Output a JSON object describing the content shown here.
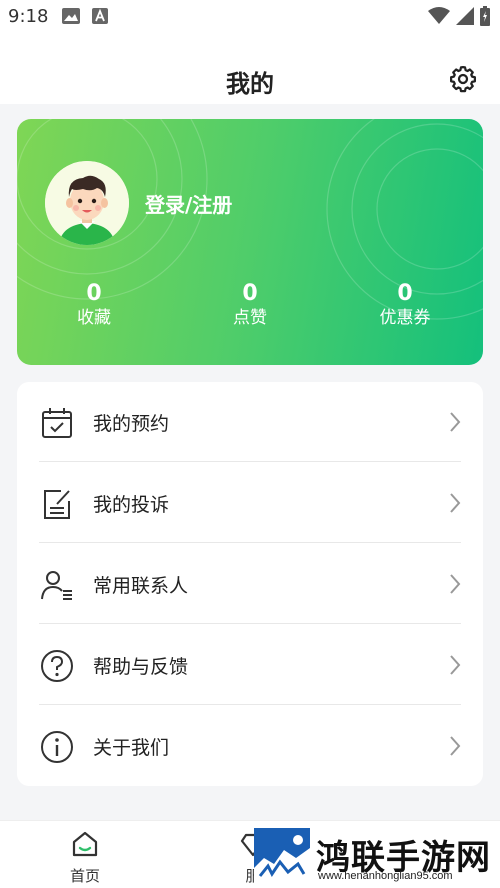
{
  "status_bar": {
    "time": "9:18"
  },
  "header": {
    "title": "我的"
  },
  "profile": {
    "login_label": "登录/注册",
    "stats": [
      {
        "value": "0",
        "label": "收藏"
      },
      {
        "value": "0",
        "label": "点赞"
      },
      {
        "value": "0",
        "label": "优惠券"
      }
    ]
  },
  "menu": {
    "items": [
      {
        "label": "我的预约",
        "icon": "calendar-check-icon"
      },
      {
        "label": "我的投诉",
        "icon": "edit-document-icon"
      },
      {
        "label": "常用联系人",
        "icon": "contacts-icon"
      },
      {
        "label": "帮助与反馈",
        "icon": "question-circle-icon"
      },
      {
        "label": "关于我们",
        "icon": "info-circle-icon"
      }
    ]
  },
  "bottom_nav": {
    "home_label": "首页",
    "service_label": "服"
  },
  "watermark": {
    "title": "鸿联手游网",
    "url": "www.henanhonglian95.com"
  },
  "colors": {
    "card_gradient_start": "#7fd655",
    "card_gradient_end": "#14c07c",
    "accent_green": "#2fbf6a"
  }
}
